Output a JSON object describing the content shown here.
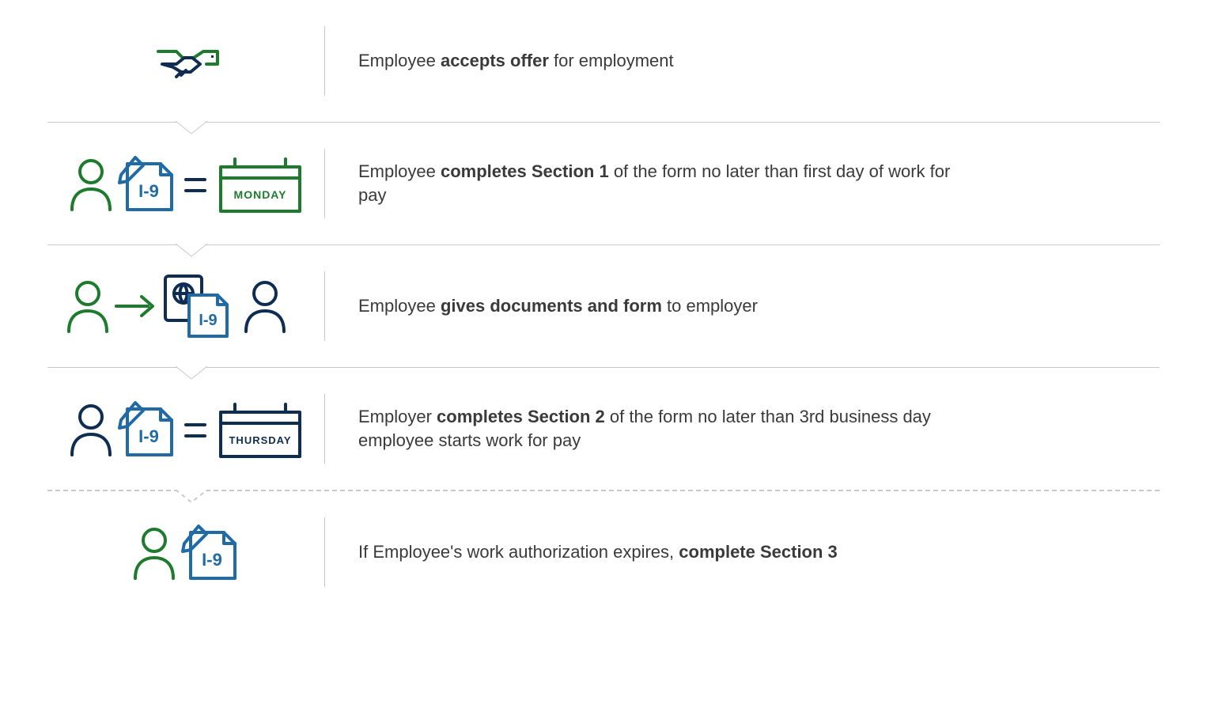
{
  "colors": {
    "green": "#1e7b2d",
    "navy": "#0f2d52",
    "blue": "#206ba5",
    "gray": "#c9c9c9",
    "text": "#3a3a3a"
  },
  "steps": [
    {
      "segments": [
        {
          "t": "Employee ",
          "b": false
        },
        {
          "t": "accepts offer",
          "b": true
        },
        {
          "t": " for employment",
          "b": false
        }
      ]
    },
    {
      "calendar_label": "MONDAY",
      "doc_label": "I-9",
      "segments": [
        {
          "t": "Employee ",
          "b": false
        },
        {
          "t": "completes Section 1",
          "b": true
        },
        {
          "t": " of the form no later than first day of work for pay",
          "b": false
        }
      ]
    },
    {
      "doc_label": "I-9",
      "segments": [
        {
          "t": "Employee ",
          "b": false
        },
        {
          "t": "gives documents and form",
          "b": true
        },
        {
          "t": " to employer",
          "b": false
        }
      ]
    },
    {
      "calendar_label": "THURSDAY",
      "doc_label": "I-9",
      "segments": [
        {
          "t": "Employer ",
          "b": false
        },
        {
          "t": "completes Section 2",
          "b": true
        },
        {
          "t": " of the form no later than 3rd business day employee starts work for pay",
          "b": false
        }
      ]
    },
    {
      "doc_label": "I-9",
      "segments": [
        {
          "t": "If Employee's work authorization expires, ",
          "b": false
        },
        {
          "t": "complete Section 3",
          "b": true
        }
      ]
    }
  ]
}
